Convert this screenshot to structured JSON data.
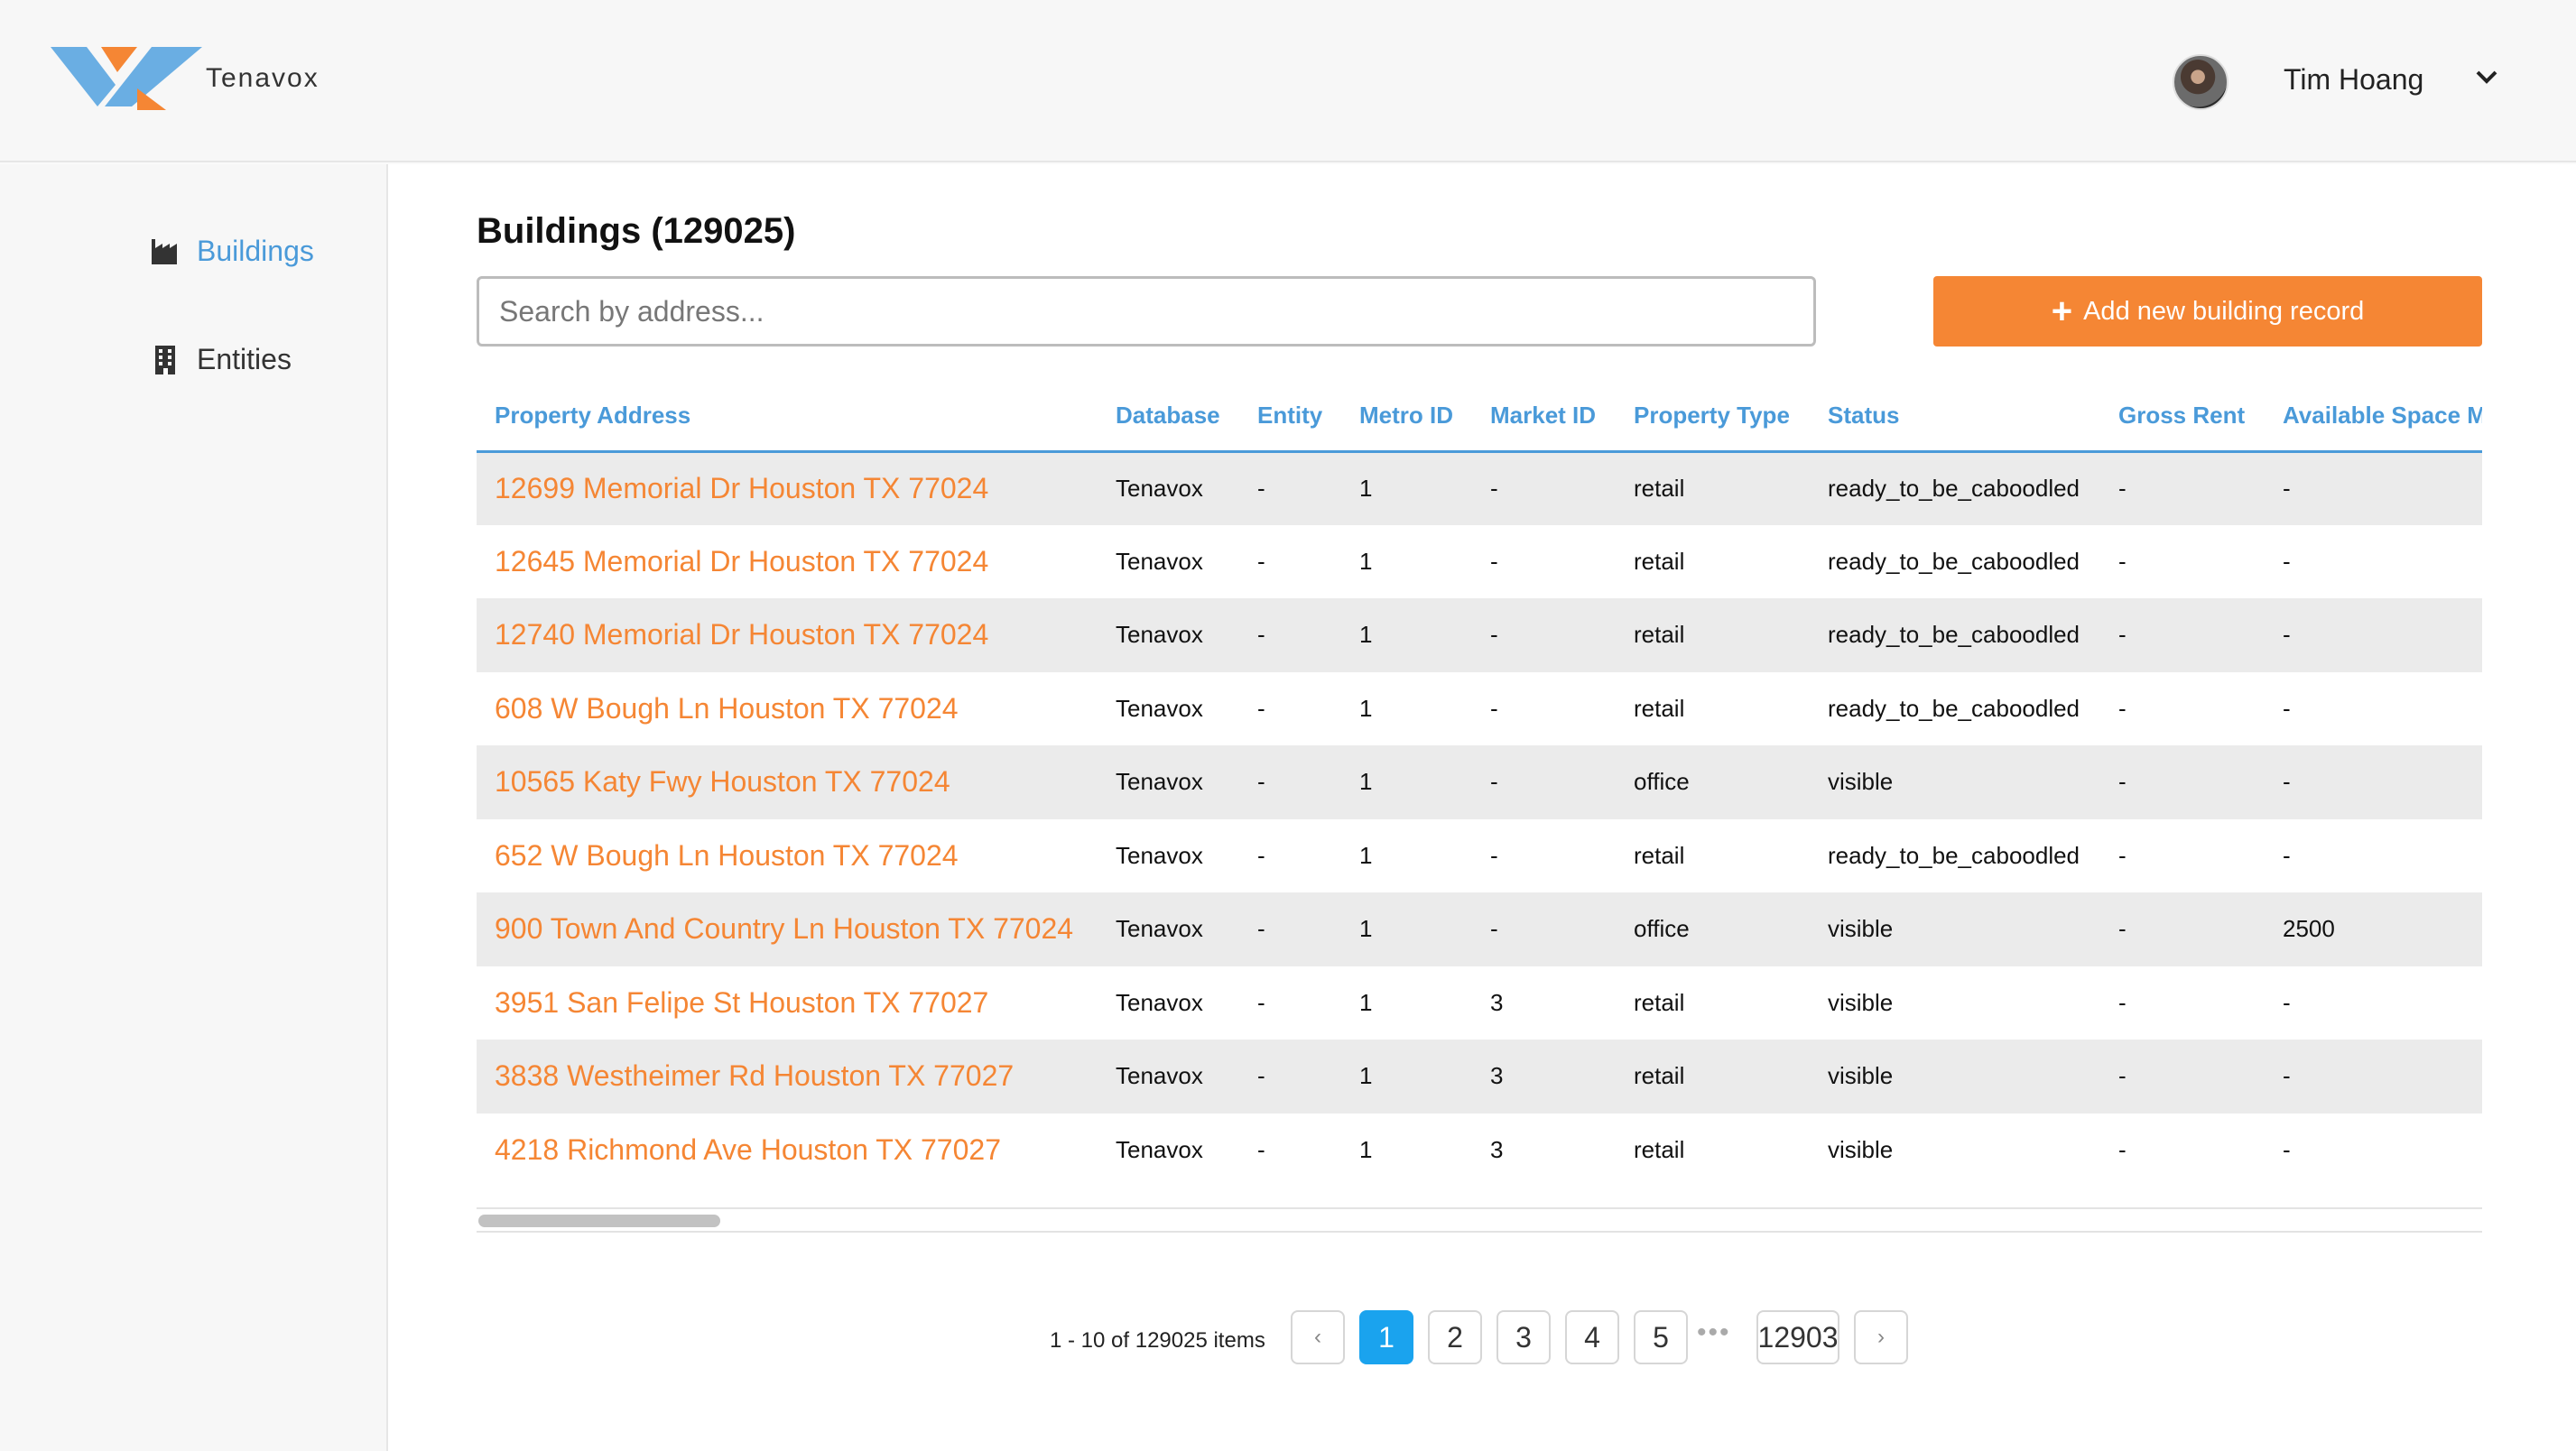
{
  "app": {
    "brand": "Tenavox",
    "colors": {
      "accent_orange": "#f58634",
      "accent_blue": "#4a9ad9",
      "logo_blue": "#6aaee3",
      "active_page": "#1aa3ee"
    }
  },
  "header": {
    "user_name": "Tim Hoang",
    "avatar_icon": "user-avatar",
    "menu_icon": "chevron-down-icon"
  },
  "sidebar": {
    "items": [
      {
        "label": "Buildings",
        "icon": "building-chart-icon",
        "active": true
      },
      {
        "label": "Entities",
        "icon": "office-building-icon",
        "active": false
      }
    ]
  },
  "main": {
    "title": "Buildings (129025)",
    "search_placeholder": "Search by address...",
    "search_value": "",
    "add_button_label": "Add new building record",
    "table": {
      "columns": [
        "Property Address",
        "Database",
        "Entity",
        "Metro ID",
        "Market ID",
        "Property Type",
        "Status",
        "Gross Rent",
        "Available Space Min"
      ],
      "rows": [
        [
          "12699 Memorial Dr Houston TX 77024",
          "Tenavox",
          "-",
          "1",
          "-",
          "retail",
          "ready_to_be_caboodled",
          "-",
          "-"
        ],
        [
          "12645 Memorial Dr Houston TX 77024",
          "Tenavox",
          "-",
          "1",
          "-",
          "retail",
          "ready_to_be_caboodled",
          "-",
          "-"
        ],
        [
          "12740 Memorial Dr Houston TX 77024",
          "Tenavox",
          "-",
          "1",
          "-",
          "retail",
          "ready_to_be_caboodled",
          "-",
          "-"
        ],
        [
          "608 W Bough Ln Houston TX 77024",
          "Tenavox",
          "-",
          "1",
          "-",
          "retail",
          "ready_to_be_caboodled",
          "-",
          "-"
        ],
        [
          "10565 Katy Fwy Houston TX 77024",
          "Tenavox",
          "-",
          "1",
          "-",
          "office",
          "visible",
          "-",
          "-"
        ],
        [
          "652 W Bough Ln Houston TX 77024",
          "Tenavox",
          "-",
          "1",
          "-",
          "retail",
          "ready_to_be_caboodled",
          "-",
          "-"
        ],
        [
          "900 Town And Country Ln Houston TX 77024",
          "Tenavox",
          "-",
          "1",
          "-",
          "office",
          "visible",
          "-",
          "2500"
        ],
        [
          "3951 San Felipe St Houston TX 77027",
          "Tenavox",
          "-",
          "1",
          "3",
          "retail",
          "visible",
          "-",
          "-"
        ],
        [
          "3838 Westheimer Rd Houston TX 77027",
          "Tenavox",
          "-",
          "1",
          "3",
          "retail",
          "visible",
          "-",
          "-"
        ],
        [
          "4218 Richmond Ave Houston TX 77027",
          "Tenavox",
          "-",
          "1",
          "3",
          "retail",
          "visible",
          "-",
          "-"
        ]
      ]
    },
    "pagination": {
      "range_text": "1 - 10 of 129025 items",
      "prev_label": "‹",
      "next_label": "›",
      "pages": [
        "1",
        "2",
        "3",
        "4",
        "5"
      ],
      "ellipsis": "•••",
      "last_page": "12903",
      "current_page": "1"
    }
  }
}
